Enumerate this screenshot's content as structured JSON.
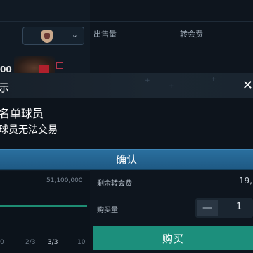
{
  "header": {
    "sold_label": "出售量",
    "fee_label": "转会费"
  },
  "player": {
    "rating_fragment": "00"
  },
  "modal": {
    "title_fragment": "示",
    "message_line1": "名单球员",
    "message_line2": "球员无法交易",
    "confirm_label": "确认",
    "close_glyph": "✕"
  },
  "chart": {
    "price_cap": "51,100,000",
    "x_ticks": [
      "0",
      "2/3",
      "3/3",
      "10"
    ]
  },
  "trade": {
    "remaining_fee_label": "剩余转会费",
    "remaining_fee_value": "19,",
    "quantity_label": "购买量",
    "quantity_value": "1",
    "minus_glyph": "—",
    "buy_label": "购买"
  },
  "colors": {
    "confirm_blue": "#2a6f9e",
    "buy_green": "#1c8f7c",
    "trend_green": "#1e8c72"
  }
}
